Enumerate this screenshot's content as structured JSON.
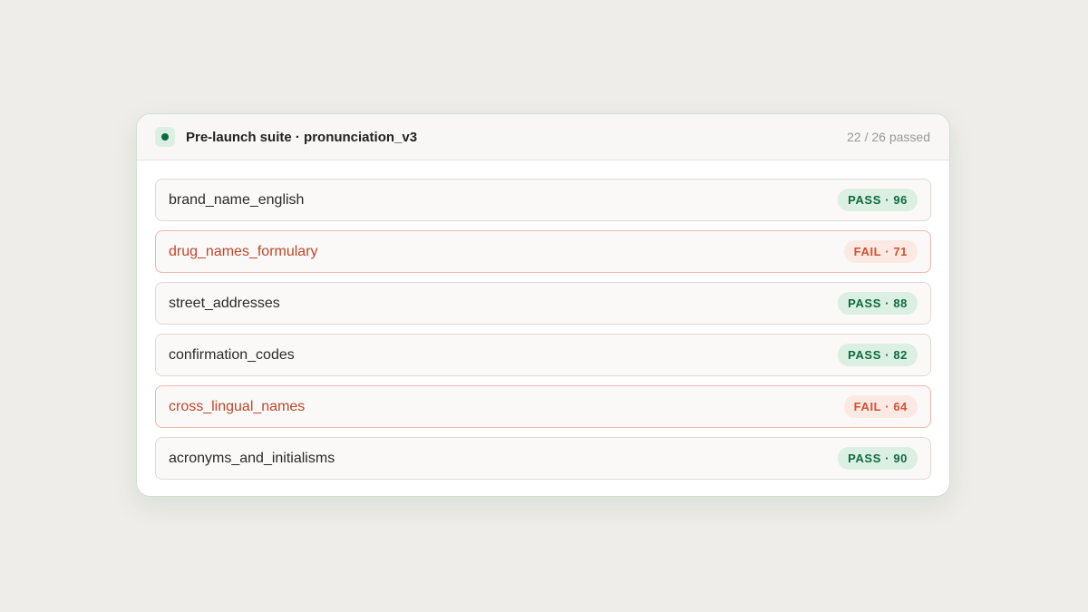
{
  "suite": {
    "title": "Pre-launch suite · pronunciation_v3",
    "summary": "22 / 26 passed"
  },
  "tests": [
    {
      "name": "brand_name_english",
      "status": "pass",
      "badge": "PASS · 96",
      "score": 96
    },
    {
      "name": "drug_names_formulary",
      "status": "fail",
      "badge": "FAIL · 71",
      "score": 71
    },
    {
      "name": "street_addresses",
      "status": "pass",
      "badge": "PASS · 88",
      "score": 88
    },
    {
      "name": "confirmation_codes",
      "status": "pass",
      "badge": "PASS · 82",
      "score": 82
    },
    {
      "name": "cross_lingual_names",
      "status": "fail",
      "badge": "FAIL · 64",
      "score": 64
    },
    {
      "name": "acronyms_and_initialisms",
      "status": "pass",
      "badge": "PASS · 90",
      "score": 90
    }
  ],
  "colors": {
    "pass": "#0e6a3f",
    "fail": "#d5502f"
  }
}
